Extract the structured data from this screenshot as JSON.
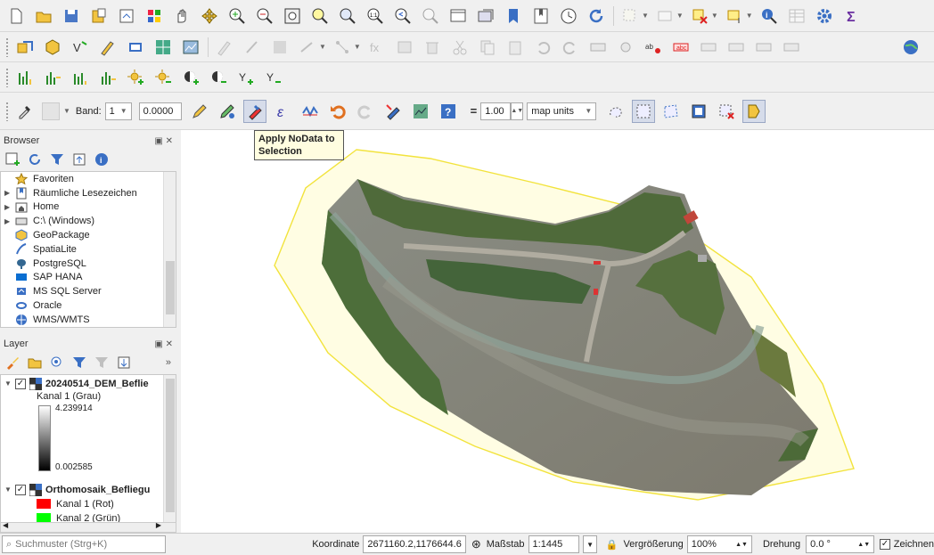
{
  "tooltip": {
    "text_line1": "Apply NoData to",
    "text_line2": "Selection"
  },
  "raster_toolbar": {
    "band_label": "Band:",
    "band_value": "1",
    "value_field": "0.0000",
    "size_value": "1.00",
    "units_value": "map units"
  },
  "browser": {
    "title": "Browser",
    "items": [
      {
        "label": "Favoriten",
        "icon": "star-icon",
        "expandable": false
      },
      {
        "label": "Räumliche Lesezeichen",
        "icon": "bookmark-icon",
        "expandable": true
      },
      {
        "label": "Home",
        "icon": "home-folder-icon",
        "expandable": true
      },
      {
        "label": "C:\\ (Windows)",
        "icon": "drive-icon",
        "expandable": true
      },
      {
        "label": "GeoPackage",
        "icon": "geopackage-icon",
        "expandable": false
      },
      {
        "label": "SpatiaLite",
        "icon": "spatialite-icon",
        "expandable": false
      },
      {
        "label": "PostgreSQL",
        "icon": "postgresql-icon",
        "expandable": false
      },
      {
        "label": "SAP HANA",
        "icon": "sap-hana-icon",
        "expandable": false
      },
      {
        "label": "MS SQL Server",
        "icon": "mssql-icon",
        "expandable": false
      },
      {
        "label": "Oracle",
        "icon": "oracle-icon",
        "expandable": false
      },
      {
        "label": "WMS/WMTS",
        "icon": "wms-icon",
        "expandable": false
      }
    ]
  },
  "layers": {
    "title": "Layer",
    "dem_layer": {
      "name": "20240514_DEM_Beflie",
      "band": "Kanal 1 (Grau)",
      "max": "4.239914",
      "min": "0.002585"
    },
    "ortho_layer": {
      "name": "Orthomosaik_Befliegu",
      "bands": [
        {
          "label": "Kanal 1 (Rot)",
          "color": "#ff0000"
        },
        {
          "label": "Kanal 2 (Grün)",
          "color": "#00ff00"
        }
      ]
    }
  },
  "statusbar": {
    "search_placeholder": "Suchmuster (Strg+K)",
    "coord_label": "Koordinate",
    "coord_value": "2671160.2,1176644.6",
    "scale_label": "Maßstab",
    "scale_value": "1:1445",
    "magnifier_label": "Vergrößerung",
    "magnifier_value": "100%",
    "rotation_label": "Drehung",
    "rotation_value": "0.0 °",
    "render_label": "Zeichnen"
  },
  "colors": {
    "accent": "#3a6fc4",
    "footprint_fill": "#fffde3",
    "footprint_stroke": "#f2e33c"
  }
}
